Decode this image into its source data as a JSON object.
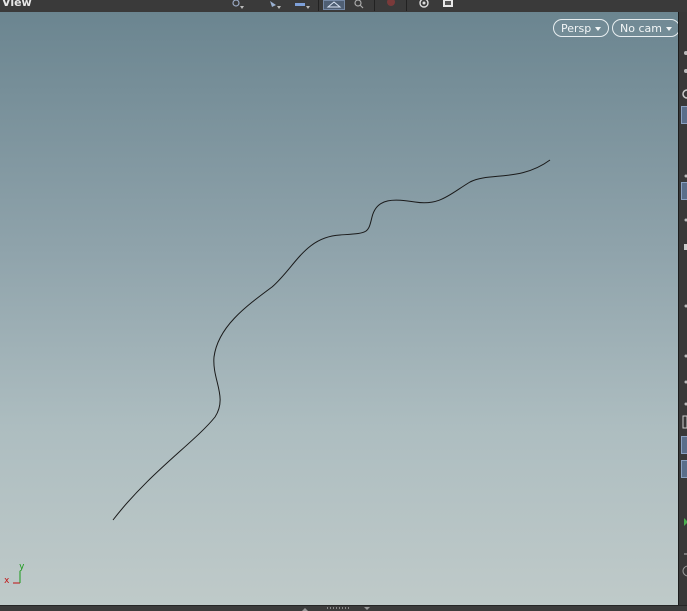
{
  "toolbar": {
    "title": "View",
    "icons": [
      "select-tool-icon",
      "transform-tool-icon",
      "handle-tool-icon",
      "wireframe-toggle-icon",
      "zoom-icon",
      "snap-icon",
      "visibility-icon",
      "camera-icon"
    ]
  },
  "viewport": {
    "persp_label": "Persp",
    "camera_label": "No cam",
    "axis": {
      "x_label": "x",
      "y_label": "y"
    },
    "background_top": "#6b8590",
    "background_bottom": "#bfcac9",
    "curve_color": "#1a1a1a"
  }
}
